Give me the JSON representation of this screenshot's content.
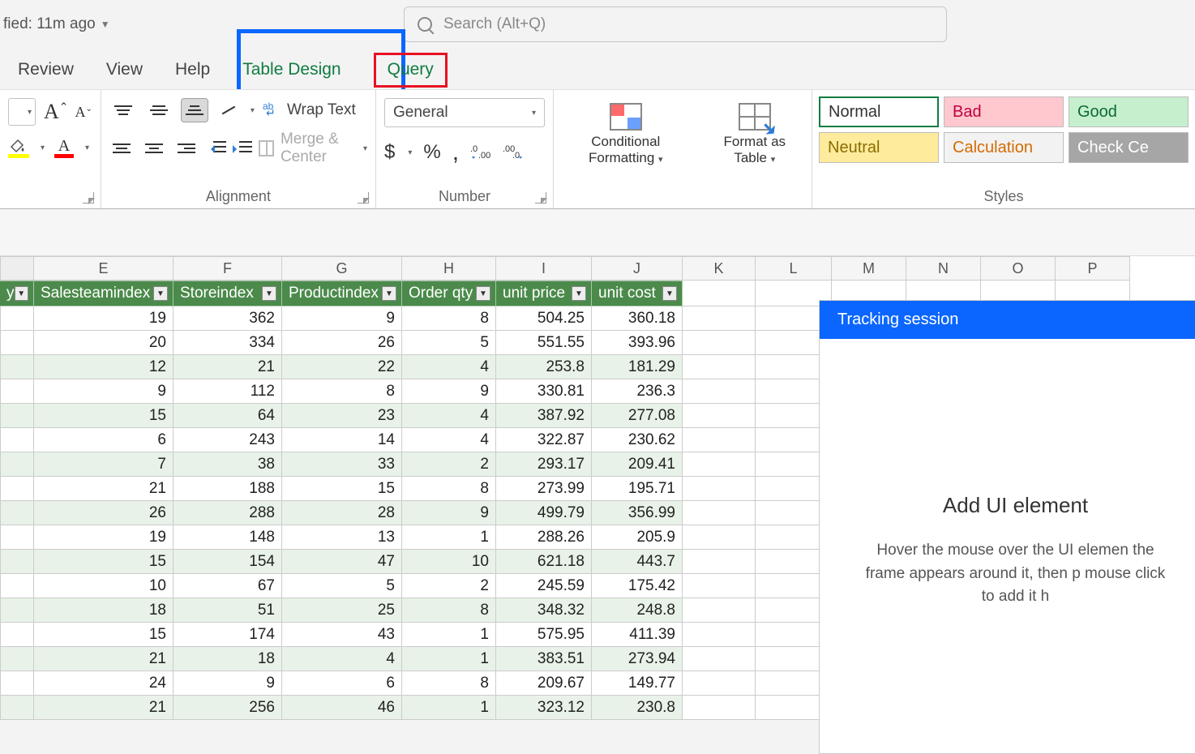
{
  "titlebar": {
    "modified": "fied: 11m ago",
    "search_placeholder": "Search (Alt+Q)"
  },
  "tabs": {
    "review": "Review",
    "view": "View",
    "help": "Help",
    "table_design": "Table Design",
    "query": "Query"
  },
  "ribbon": {
    "wrap_text": "Wrap Text",
    "merge_center": "Merge & Center",
    "alignment_label": "Alignment",
    "number_format": "General",
    "number_label": "Number",
    "conditional_formatting": "Conditional Formatting",
    "format_as_table": "Format as Table",
    "styles_label": "Styles",
    "styles": {
      "normal": "Normal",
      "bad": "Bad",
      "good": "Good",
      "neutral": "Neutral",
      "calculation": "Calculation",
      "check_cell": "Check Ce"
    }
  },
  "columns": {
    "E": "E",
    "F": "F",
    "G": "G",
    "H": "H",
    "I": "I",
    "J": "J",
    "K": "K",
    "L": "L",
    "M": "M",
    "N": "N",
    "O": "O",
    "P": "P"
  },
  "table": {
    "headers": {
      "D": "y",
      "E": "Salesteamindex",
      "F": "Storeindex",
      "G": "Productindex",
      "H": "Order qty",
      "I": "unit price",
      "J": "unit cost"
    },
    "rows": [
      {
        "E": "19",
        "F": "362",
        "G": "9",
        "H": "8",
        "I": "504.25",
        "J": "360.18"
      },
      {
        "E": "20",
        "F": "334",
        "G": "26",
        "H": "5",
        "I": "551.55",
        "J": "393.96"
      },
      {
        "E": "12",
        "F": "21",
        "G": "22",
        "H": "4",
        "I": "253.8",
        "J": "181.29"
      },
      {
        "E": "9",
        "F": "112",
        "G": "8",
        "H": "9",
        "I": "330.81",
        "J": "236.3"
      },
      {
        "E": "15",
        "F": "64",
        "G": "23",
        "H": "4",
        "I": "387.92",
        "J": "277.08"
      },
      {
        "E": "6",
        "F": "243",
        "G": "14",
        "H": "4",
        "I": "322.87",
        "J": "230.62"
      },
      {
        "E": "7",
        "F": "38",
        "G": "33",
        "H": "2",
        "I": "293.17",
        "J": "209.41"
      },
      {
        "E": "21",
        "F": "188",
        "G": "15",
        "H": "8",
        "I": "273.99",
        "J": "195.71"
      },
      {
        "E": "26",
        "F": "288",
        "G": "28",
        "H": "9",
        "I": "499.79",
        "J": "356.99"
      },
      {
        "E": "19",
        "F": "148",
        "G": "13",
        "H": "1",
        "I": "288.26",
        "J": "205.9"
      },
      {
        "E": "15",
        "F": "154",
        "G": "47",
        "H": "10",
        "I": "621.18",
        "J": "443.7"
      },
      {
        "E": "10",
        "F": "67",
        "G": "5",
        "H": "2",
        "I": "245.59",
        "J": "175.42"
      },
      {
        "E": "18",
        "F": "51",
        "G": "25",
        "H": "8",
        "I": "348.32",
        "J": "248.8"
      },
      {
        "E": "15",
        "F": "174",
        "G": "43",
        "H": "1",
        "I": "575.95",
        "J": "411.39"
      },
      {
        "E": "21",
        "F": "18",
        "G": "4",
        "H": "1",
        "I": "383.51",
        "J": "273.94"
      },
      {
        "E": "24",
        "F": "9",
        "G": "6",
        "H": "8",
        "I": "209.67",
        "J": "149.77"
      },
      {
        "E": "21",
        "F": "256",
        "G": "46",
        "H": "1",
        "I": "323.12",
        "J": "230.8"
      }
    ]
  },
  "tracking": {
    "title": "Tracking session",
    "heading": "Add UI element",
    "body": "Hover the mouse over the UI elemen the frame appears around it, then p mouse click to add it h"
  }
}
